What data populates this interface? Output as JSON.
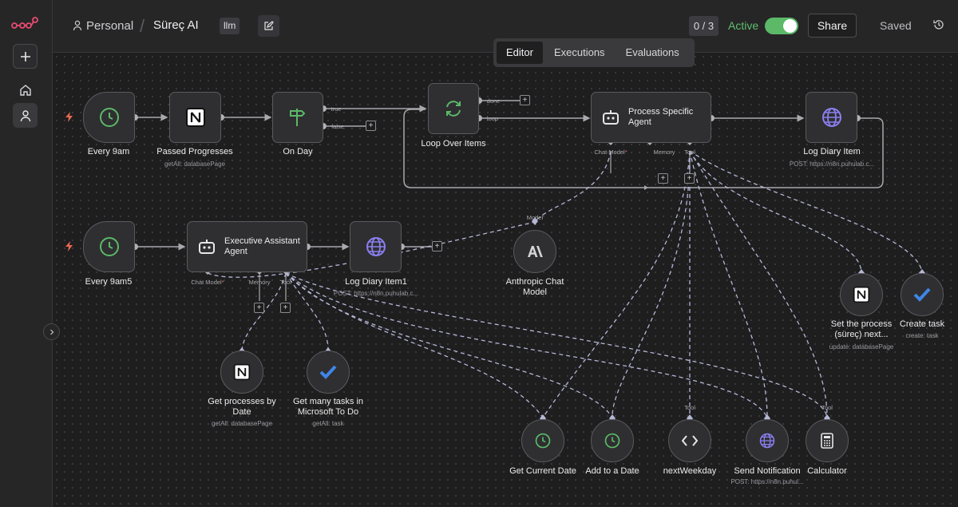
{
  "header": {
    "project": "Personal",
    "workflow_title": "Süreç AI",
    "tag": "llm",
    "executions_counter": "0 / 3",
    "active_label": "Active",
    "share_label": "Share",
    "saved_label": "Saved"
  },
  "tabs": [
    "Editor",
    "Executions",
    "Evaluations"
  ],
  "nodes": {
    "every9am": {
      "label": "Every 9am"
    },
    "passed": {
      "label": "Passed Progresses",
      "sub": "getAll: databasePage"
    },
    "onday": {
      "label": "On Day",
      "out_true": "true",
      "out_false": "false"
    },
    "loop": {
      "label": "Loop Over Items",
      "out_done": "done",
      "out_loop": "loop"
    },
    "process": {
      "label": "Process Specific Agent",
      "p_chat": "Chat Model",
      "p_memory": "Memory",
      "p_tool": "Tool"
    },
    "logdiary": {
      "label": "Log Diary Item",
      "sub": "POST: https://n8n.puhulab.c..."
    },
    "every9am5": {
      "label": "Every 9am5"
    },
    "exec": {
      "label": "Executive Assistant Agent",
      "p_chat": "Chat Model",
      "p_memory": "Memory",
      "p_tool": "Tool"
    },
    "logdiary1": {
      "label": "Log Diary Item1",
      "sub": "POST: https://n8n.puhulab.c..."
    },
    "anthropic": {
      "label": "Anthropic Chat Model",
      "port": "Model"
    },
    "setprocess": {
      "label": "Set the process (süreç) next...",
      "sub": "update: databasePage"
    },
    "createtask": {
      "label": "Create task",
      "sub": "create: task"
    },
    "getprocesses": {
      "label": "Get processes by Date",
      "sub": "getAll: databasePage"
    },
    "gettasks": {
      "label": "Get many tasks in Microsoft To Do",
      "sub": "getAll: task"
    },
    "getdate": {
      "label": "Get Current Date"
    },
    "adddate": {
      "label": "Add to a Date"
    },
    "nextweekday": {
      "label": "nextWeekday",
      "port": "Tool"
    },
    "sendnotif": {
      "label": "Send Notification",
      "sub": "POST: https://n8n.puhul..."
    },
    "calculator": {
      "label": "Calculator",
      "port": "Tool"
    }
  },
  "colors": {
    "accent_green": "#5bb968",
    "wire": "#a9a9ad",
    "ai_wire": "#b5b7d6",
    "trigger_bolt": "#e8684f",
    "globe": "#8a7ff0",
    "todo": "#3f86e6"
  }
}
